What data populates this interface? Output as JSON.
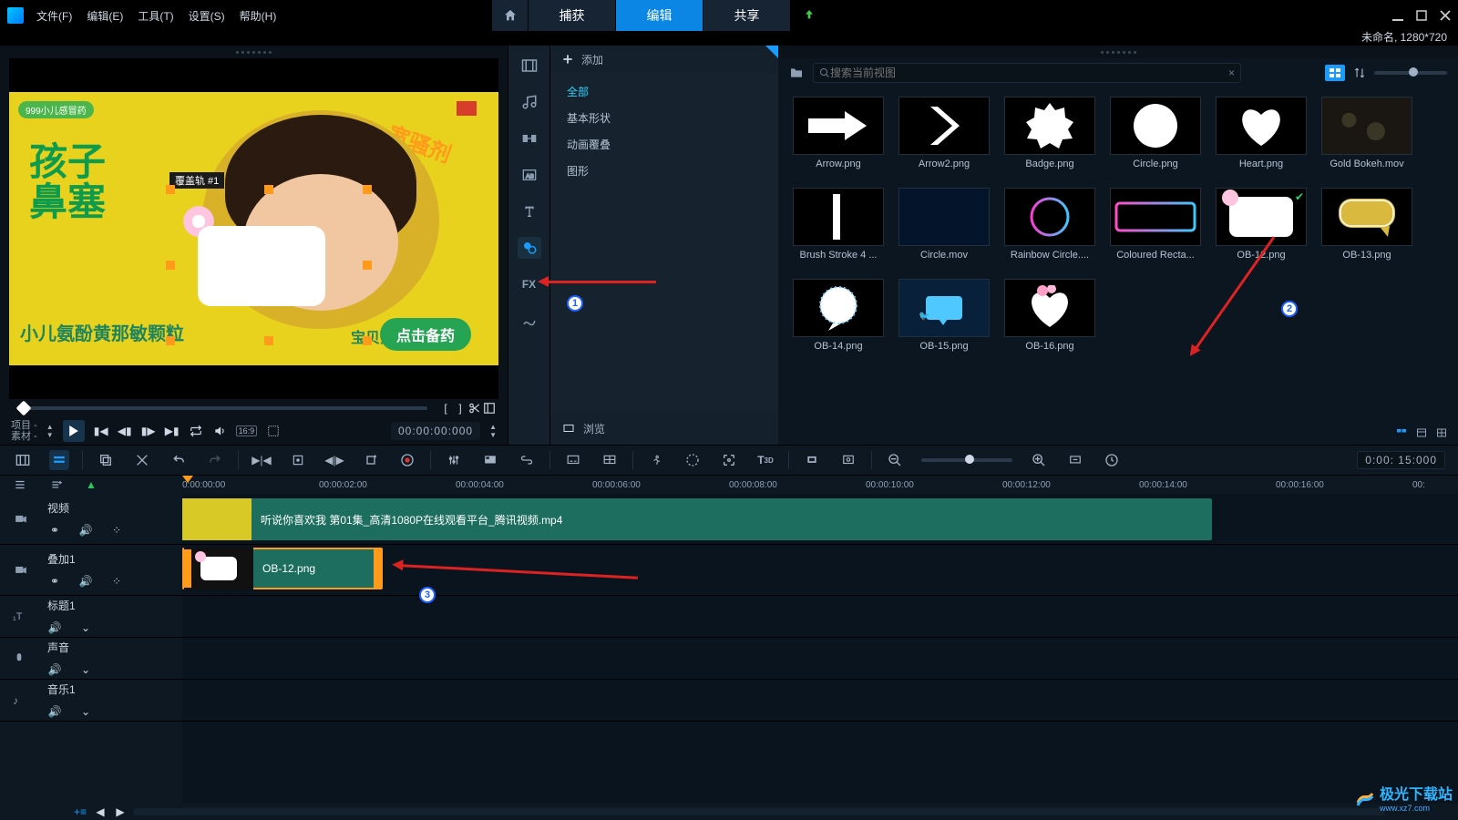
{
  "menu": {
    "file": "文件(F)",
    "edit": "编辑(E)",
    "tools": "工具(T)",
    "settings": "设置(S)",
    "help": "帮助(H)"
  },
  "tabs": {
    "capture": "捕获",
    "edit": "编辑",
    "share": "共享"
  },
  "project": {
    "title": "未命名, 1280*720"
  },
  "preview": {
    "labelProject": "项目 -",
    "labelMaterial": "素材 -",
    "ratio": "16:9",
    "timecode": "00:00:00:000",
    "overlayTrack": "覆盖轨 #1",
    "ad": {
      "brand": "999小儿感冒药",
      "big1": "孩子",
      "big2": "鼻塞",
      "sub": "小儿氨酚黄那敏颗粒",
      "sub2": "宝贝开学不慌张",
      "cta": "点击备药",
      "mark": "宽骚剂"
    }
  },
  "library": {
    "add": "添加",
    "browse": "浏览",
    "cats": {
      "all": "全部",
      "basic": "基本形状",
      "anim": "动画覆叠",
      "graphic": "图形"
    },
    "search": {
      "ph": "搜索当前视图"
    },
    "items": [
      {
        "cap": "Arrow.png",
        "t": "arrow"
      },
      {
        "cap": "Arrow2.png",
        "t": "chev"
      },
      {
        "cap": "Badge.png",
        "t": "badge"
      },
      {
        "cap": "Circle.png",
        "t": "circle"
      },
      {
        "cap": "Heart.png",
        "t": "heart"
      },
      {
        "cap": "Gold Bokeh.mov",
        "t": "bokeh"
      },
      {
        "cap": "Brush Stroke 4 ...",
        "t": "brush"
      },
      {
        "cap": "Circle.mov",
        "t": "circ2"
      },
      {
        "cap": "Rainbow Circle....",
        "t": "rcircle"
      },
      {
        "cap": "Coloured Recta...",
        "t": "crect"
      },
      {
        "cap": "OB-12.png",
        "t": "ob12",
        "chk": true
      },
      {
        "cap": "OB-13.png",
        "t": "ob13"
      },
      {
        "cap": "OB-14.png",
        "t": "ob14"
      },
      {
        "cap": "OB-15.png",
        "t": "ob15"
      },
      {
        "cap": "OB-16.png",
        "t": "ob16"
      }
    ]
  },
  "timeline": {
    "tc": "0:00: 15:000",
    "ticks": [
      "0:00:00:00",
      "00:00:02:00",
      "00:00:04:00",
      "00:00:06:00",
      "00:00:08:00",
      "00:00:10:00",
      "00:00:12:00",
      "00:00:14:00",
      "00:00:16:00",
      "00:"
    ],
    "tracks": {
      "video": "视频",
      "overlay": "叠加1",
      "title": "标题1",
      "voice": "声音",
      "music": "音乐1"
    },
    "clip1": "听说你喜欢我 第01集_高清1080P在线观看平台_腾讯视频.mp4",
    "clip2": "OB-12.png"
  },
  "annotations": {
    "n1": "1",
    "n2": "2",
    "n3": "3"
  },
  "watermark": {
    "name": "极光下载站",
    "url": "www.xz7.com"
  }
}
